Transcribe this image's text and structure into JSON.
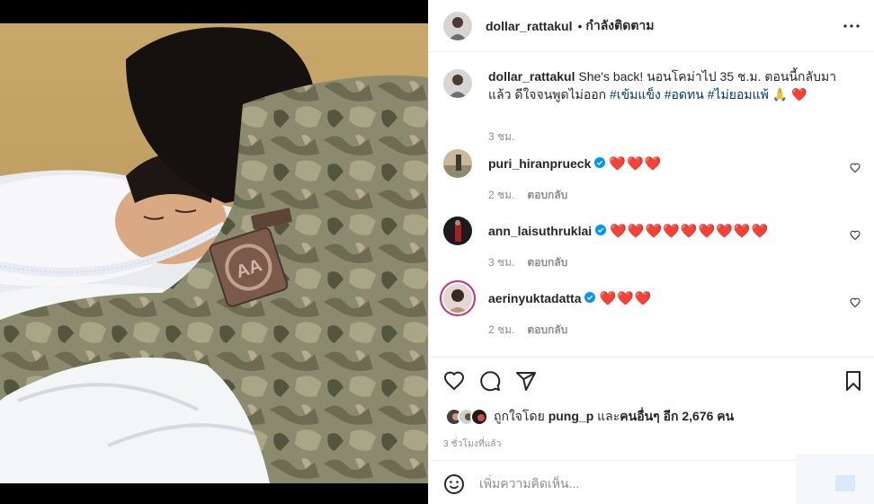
{
  "post": {
    "author": "dollar_rattakul",
    "follow_status": "กำลังติดตาม",
    "caption_prefix": "She's back! นอนโคม่าไป 35 ช.ม. ตอนนี้กลับมาแล้ว ดีใจจนพูดไม่ออก ",
    "hashtags": [
      "#เข้มแข็ง",
      "#อดทน",
      "#ไม่ยอมแพ้"
    ],
    "caption_suffix": " 🙏 ❤️",
    "caption_time": "3 ชม."
  },
  "comments": [
    {
      "username": "puri_hiranprueck",
      "verified": true,
      "text": "❤️❤️❤️",
      "time": "2 ชม.",
      "reply_label": "ตอบกลับ"
    },
    {
      "username": "ann_laisuthruklai",
      "verified": true,
      "text": "❤️❤️❤️❤️❤️❤️❤️❤️❤️",
      "time": "3 ชม.",
      "reply_label": "ตอบกลับ"
    },
    {
      "username": "aerinyuktadatta",
      "verified": true,
      "text": "❤️❤️❤️",
      "time": "2 ชม.",
      "reply_label": "ตอบกลับ"
    }
  ],
  "likes": {
    "prefix": "ถูกใจโดย ",
    "user": "pung_p",
    "middle": " และ",
    "others": "คนอื่นๆ อีก 2,676 คน"
  },
  "post_time": "3 ชั่วโมงที่แล้ว",
  "add_comment": {
    "placeholder": "เพิ่มความคิดเห็น..."
  },
  "icons": {
    "more": "more-horizontal-icon",
    "like": "heart-icon",
    "comment": "comment-bubble-icon",
    "share": "paper-plane-icon",
    "save": "bookmark-icon",
    "emoji": "emoji-smile-icon",
    "verified": "verified-badge-icon"
  },
  "colors": {
    "verified": "#0095f6",
    "heart": "#ed1c3b",
    "hashtag": "#00376b",
    "muted": "#8e8e8e"
  }
}
